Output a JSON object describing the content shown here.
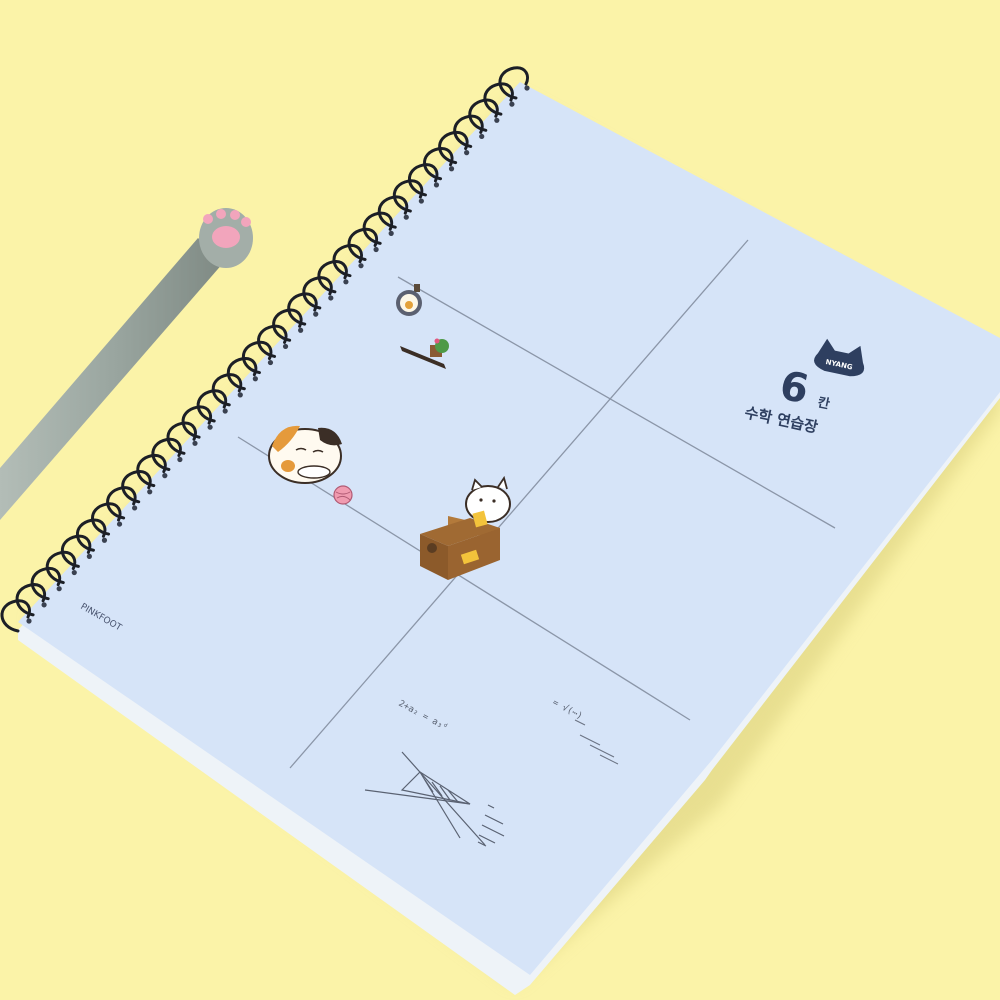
{
  "cover": {
    "badge_text": "NYANG",
    "volume_number": "6",
    "volume_suffix": "칸",
    "subtitle": "수학 연습장",
    "brand": "PINKFOOT",
    "color": "#d6e4f8"
  },
  "pen": {
    "body_color": "#9aa6a0",
    "paw_color": "#f2a5bc"
  },
  "background_color": "#fbf3a8",
  "doodles": {
    "formula_left": "2+a₂ = a₃ᵈ",
    "formula_right": "= √(⋯)"
  }
}
